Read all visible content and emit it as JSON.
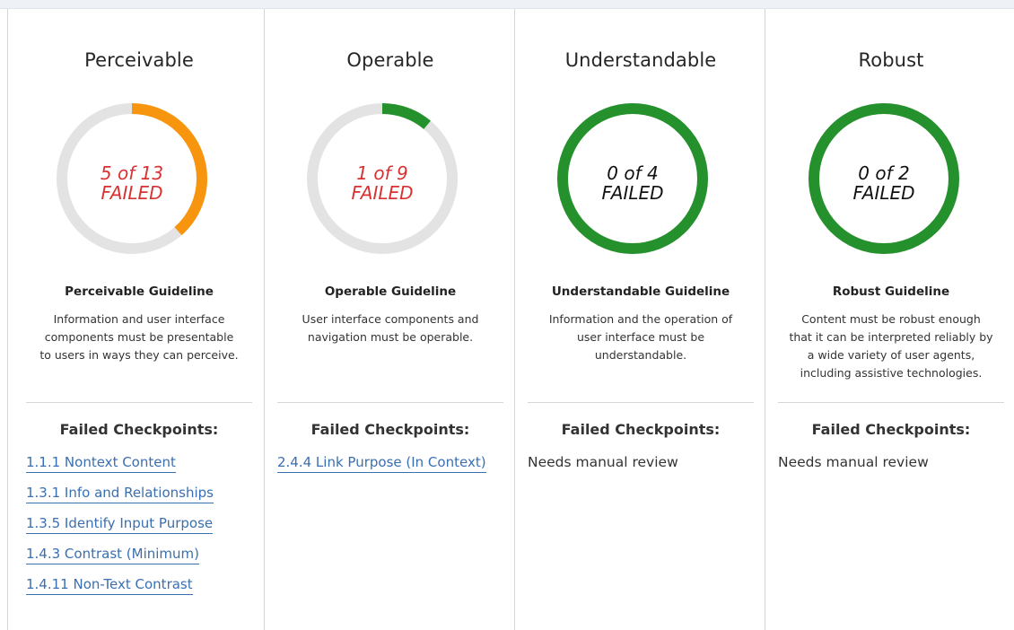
{
  "colors": {
    "failed_text": "#d93131",
    "ok_text": "#111111",
    "track": "#e3e3e3",
    "warn_arc": "#f7960e",
    "pass_arc": "#25912d",
    "link": "#3a6fb0"
  },
  "columns": [
    {
      "title": "Perceivable",
      "failed": 5,
      "total": 13,
      "progress": 0.385,
      "status": "warn",
      "label_line1": "5 of 13",
      "label_line2": "FAILED",
      "guideline_title": "Perceivable Guideline",
      "guideline_desc_lines": [
        "Information and user interface",
        "components must be presentable",
        "to users in ways they can perceive."
      ],
      "checkpoints_title": "Failed Checkpoints:",
      "checkpoints": [
        "1.1.1 Nontext Content",
        "1.3.1 Info and Relationships",
        "1.3.5 Identify Input Purpose",
        "1.4.3 Contrast (Minimum)",
        "1.4.11 Non-Text Contrast"
      ],
      "manual_review": ""
    },
    {
      "title": "Operable",
      "failed": 1,
      "total": 9,
      "progress": 0.111,
      "status": "pass",
      "label_line1": "1 of 9",
      "label_line2": "FAILED",
      "guideline_title": "Operable Guideline",
      "guideline_desc_lines": [
        "User interface components and",
        "navigation must be operable."
      ],
      "checkpoints_title": "Failed Checkpoints:",
      "checkpoints": [
        "2.4.4 Link Purpose (In Context)"
      ],
      "manual_review": ""
    },
    {
      "title": "Understandable",
      "failed": 0,
      "total": 4,
      "progress": 1.0,
      "status": "pass",
      "label_line1": "0 of 4",
      "label_line2": "FAILED",
      "guideline_title": "Understandable Guideline",
      "guideline_desc_lines": [
        "Information and the operation of",
        "user interface must be",
        "understandable."
      ],
      "checkpoints_title": "Failed Checkpoints:",
      "checkpoints": [],
      "manual_review": "Needs manual review"
    },
    {
      "title": "Robust",
      "failed": 0,
      "total": 2,
      "progress": 1.0,
      "status": "pass",
      "label_line1": "0 of 2",
      "label_line2": "FAILED",
      "guideline_title": "Robust Guideline",
      "guideline_desc_lines": [
        "Content must be robust enough",
        "that it can be interpreted reliably by",
        "a wide variety of user agents,",
        "including assistive technologies."
      ],
      "checkpoints_title": "Failed Checkpoints:",
      "checkpoints": [],
      "manual_review": "Needs manual review"
    }
  ]
}
